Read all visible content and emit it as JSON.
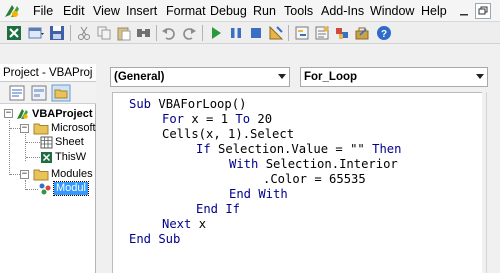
{
  "menu": {
    "items": [
      "File",
      "Edit",
      "View",
      "Insert",
      "Format",
      "Debug",
      "Run",
      "Tools",
      "Add-Ins",
      "Window",
      "Help"
    ]
  },
  "toolbar": {
    "icons": [
      "excel-icon",
      "insert-userform-icon",
      "save-icon",
      "cut-icon",
      "copy-icon",
      "paste-icon",
      "find-icon",
      "undo-icon",
      "redo-icon",
      "run-icon",
      "break-icon",
      "reset-icon",
      "design-mode-icon",
      "project-explorer-icon",
      "properties-icon",
      "object-browser-icon",
      "toolbox-icon",
      "help-icon"
    ]
  },
  "project": {
    "title": "Project - VBAProj",
    "tree": {
      "root": "VBAProject",
      "microsoft": "Microsoft",
      "sheet": "Sheet",
      "this_workbook": "ThisW",
      "modules": "Modules",
      "module": "Modul"
    }
  },
  "code": {
    "object_combo": "(General)",
    "procedure_combo": "For_Loop",
    "lines": {
      "l1": {
        "kw1": "Sub",
        "text1": " VBAForLoop()"
      },
      "l2": {
        "kw1": "For",
        "text1": " x = 1 ",
        "kw2": "To",
        "text2": " 20"
      },
      "l3": {
        "text1": "Cells(x, 1).Select"
      },
      "l4": {
        "kw1": "If",
        "text1": " Selection.Value = \"\" ",
        "kw2": "Then"
      },
      "l5": {
        "kw1": "With",
        "text1": " Selection.Interior"
      },
      "l6": {
        "text1": ".Color = 65535"
      },
      "l7": {
        "kw1": "End With"
      },
      "l8": {
        "kw1": "End If"
      },
      "l9": {
        "kw1": "Next",
        "text1": " x"
      },
      "l10": {
        "kw1": "End Sub"
      }
    }
  },
  "colors": {
    "keyword": "#00008b",
    "selection": "#3399ff"
  }
}
